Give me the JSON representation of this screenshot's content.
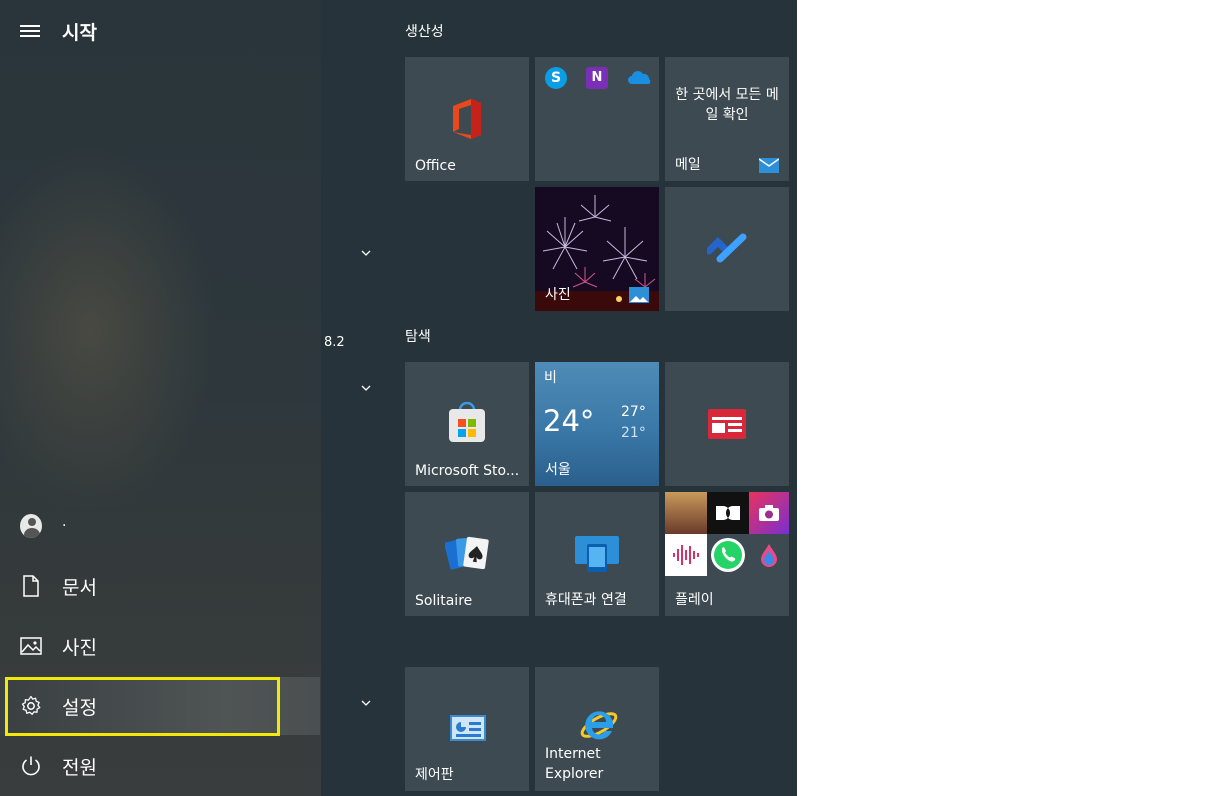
{
  "header": {
    "title": "시작",
    "menu_icon": "hamburger-icon"
  },
  "user": {
    "name": "·",
    "icon": "user-avatar-icon"
  },
  "nav": [
    {
      "label": "문서",
      "icon": "document-icon"
    },
    {
      "label": "사진",
      "icon": "picture-icon"
    },
    {
      "label": "설정",
      "icon": "gear-icon",
      "highlighted": true
    },
    {
      "label": "전원",
      "icon": "power-icon"
    }
  ],
  "app_list": {
    "partial_text": "8.2"
  },
  "groups": [
    {
      "header": "생산성"
    },
    {
      "header": "탐색"
    }
  ],
  "tiles": {
    "office": {
      "label": "Office"
    },
    "office_apps": {
      "icons": [
        "skype-icon",
        "onenote-icon",
        "onedrive-icon"
      ]
    },
    "mail": {
      "label": "메일",
      "message": "한 곳에서 모든 메일 확인"
    },
    "photos": {
      "label": "사진"
    },
    "todo": {
      "icon": "todo-check-icon"
    },
    "store": {
      "label": "Microsoft Sto..."
    },
    "weather": {
      "condition": "비",
      "temp": "24°",
      "high": "27°",
      "low": "21°",
      "city": "서울"
    },
    "news": {
      "icon": "news-icon"
    },
    "solitaire": {
      "label": "Solitaire"
    },
    "phone": {
      "label": "휴대폰과 연결"
    },
    "play": {
      "label": "플레이"
    },
    "control_panel": {
      "label": "제어판"
    },
    "ie": {
      "label_line1": "Internet",
      "label_line2": "Explorer"
    }
  },
  "colors": {
    "highlight_border": "#f2e80d",
    "start_bg": "#26333a",
    "tile_bg": "#3d4a51"
  }
}
